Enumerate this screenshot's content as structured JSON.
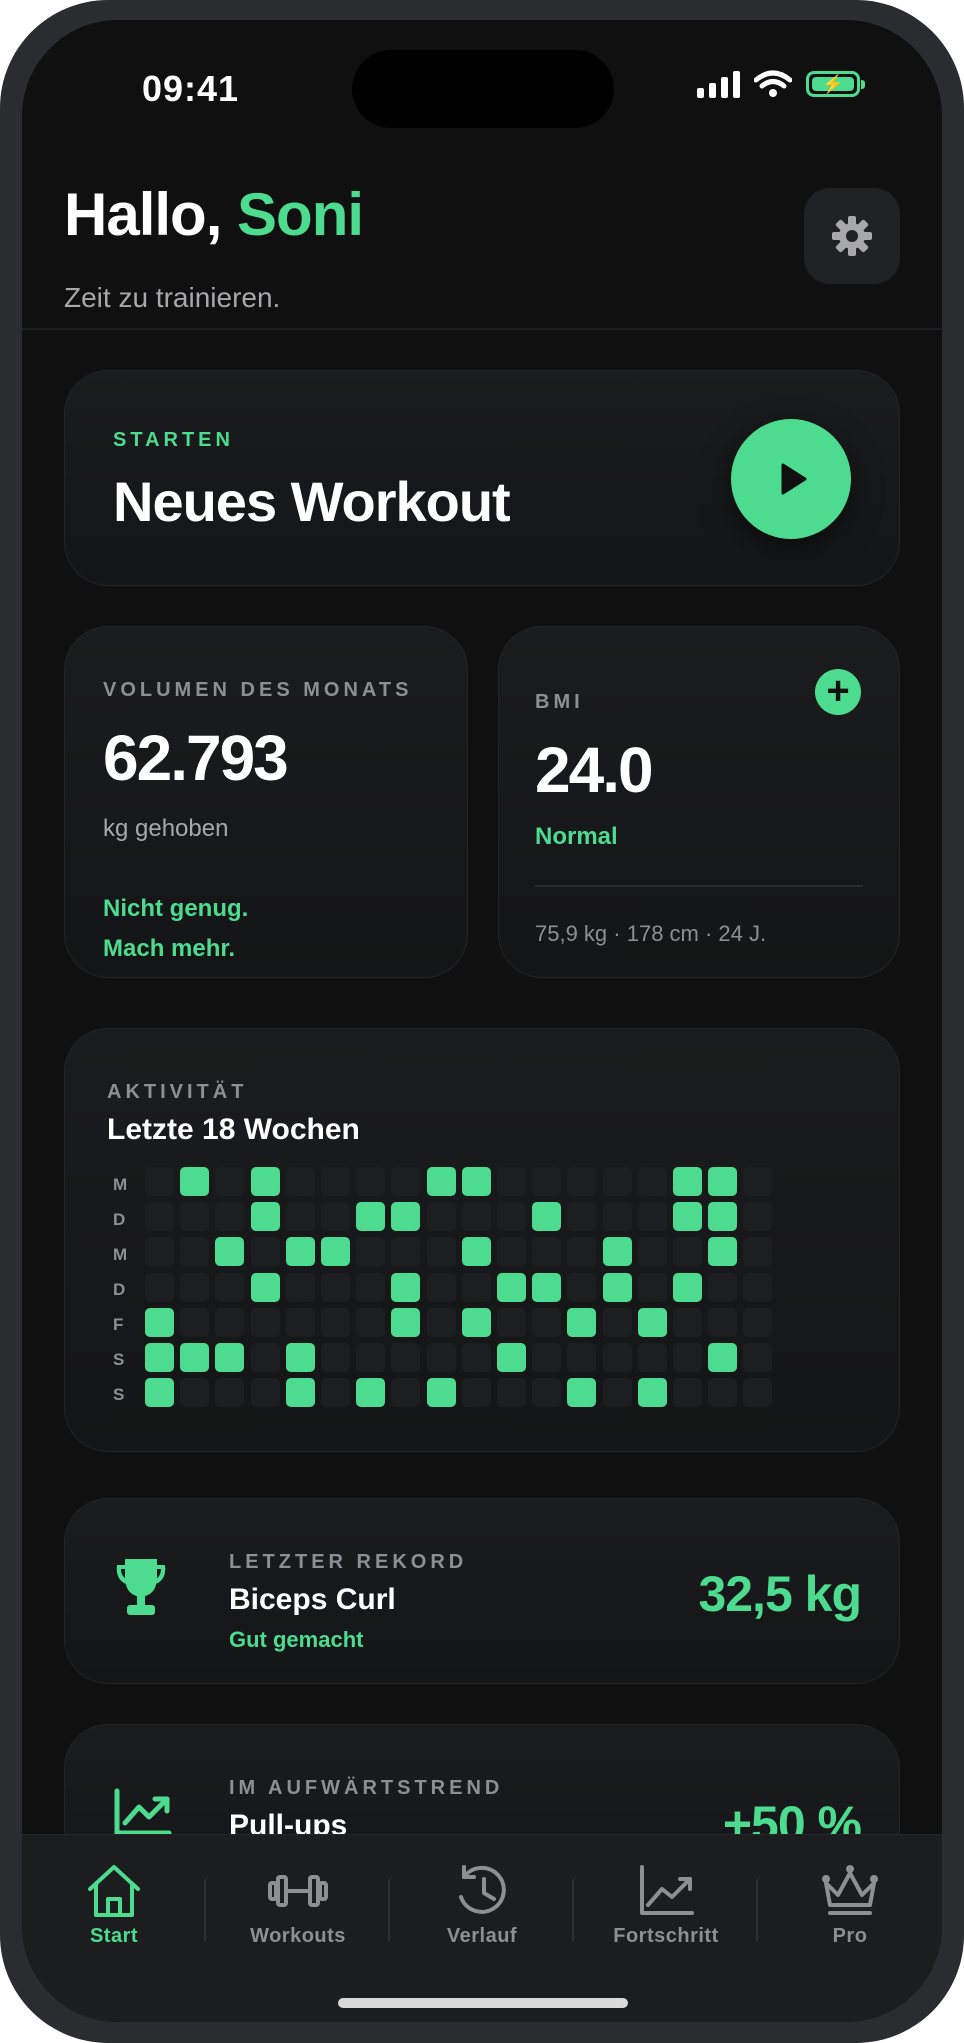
{
  "status_bar": {
    "time": "09:41"
  },
  "header": {
    "greeting_prefix": "Hallo, ",
    "user_name": "Soni",
    "subtitle": "Zeit zu trainieren."
  },
  "start_card": {
    "label": "STARTEN",
    "title": "Neues Workout"
  },
  "volume_card": {
    "label": "VOLUMEN DES MONATS",
    "value": "62.793",
    "unit": "kg gehoben",
    "message_line1": "Nicht genug.",
    "message_line2": "Mach mehr."
  },
  "bmi_card": {
    "label": "BMI",
    "value": "24.0",
    "status": "Normal",
    "details": "75,9 kg · 178 cm · 24 J."
  },
  "activity_card": {
    "label": "AKTIVITÄT",
    "title": "Letzte 18 Wochen",
    "day_labels": [
      "M",
      "D",
      "M",
      "D",
      "F",
      "S",
      "S"
    ],
    "weeks": 18,
    "active_days": [
      [
        0,
        1,
        0,
        1,
        0,
        0,
        0,
        0,
        1,
        1,
        0,
        0,
        0,
        0,
        0,
        1,
        1,
        0
      ],
      [
        0,
        0,
        0,
        1,
        0,
        0,
        1,
        1,
        0,
        0,
        0,
        1,
        0,
        0,
        0,
        1,
        1,
        0
      ],
      [
        0,
        0,
        1,
        0,
        1,
        1,
        0,
        0,
        0,
        1,
        0,
        0,
        0,
        1,
        0,
        0,
        1,
        0
      ],
      [
        0,
        0,
        0,
        1,
        0,
        0,
        0,
        1,
        0,
        0,
        1,
        1,
        0,
        1,
        0,
        1,
        0,
        0
      ],
      [
        1,
        0,
        0,
        0,
        0,
        0,
        0,
        1,
        0,
        1,
        0,
        0,
        1,
        0,
        1,
        0,
        0,
        0
      ],
      [
        1,
        1,
        1,
        0,
        1,
        0,
        0,
        0,
        0,
        0,
        1,
        0,
        0,
        0,
        0,
        0,
        1,
        0
      ],
      [
        1,
        0,
        0,
        0,
        1,
        0,
        1,
        0,
        1,
        0,
        0,
        0,
        1,
        0,
        1,
        0,
        0,
        0
      ]
    ]
  },
  "record_card": {
    "label": "LETZTER REKORD",
    "exercise": "Biceps Curl",
    "subtitle": "Gut gemacht",
    "value": "32,5 kg",
    "icon": "trophy-icon"
  },
  "trend_card": {
    "label": "IM AUFWÄRTSTREND",
    "exercise": "Pull-ups",
    "value": "+50 %",
    "icon": "trend-up-icon"
  },
  "tab_bar": {
    "tabs": [
      {
        "label": "Start",
        "icon": "home-icon",
        "active": true
      },
      {
        "label": "Workouts",
        "icon": "dumbbell-icon",
        "active": false
      },
      {
        "label": "Verlauf",
        "icon": "history-icon",
        "active": false
      },
      {
        "label": "Fortschritt",
        "icon": "chart-icon",
        "active": false
      },
      {
        "label": "Pro",
        "icon": "crown-icon",
        "active": false
      }
    ]
  },
  "colors": {
    "accent": "#4ddc8f",
    "background": "#101011",
    "card": "#1a1b1c",
    "muted_text": "#8e8f93"
  }
}
